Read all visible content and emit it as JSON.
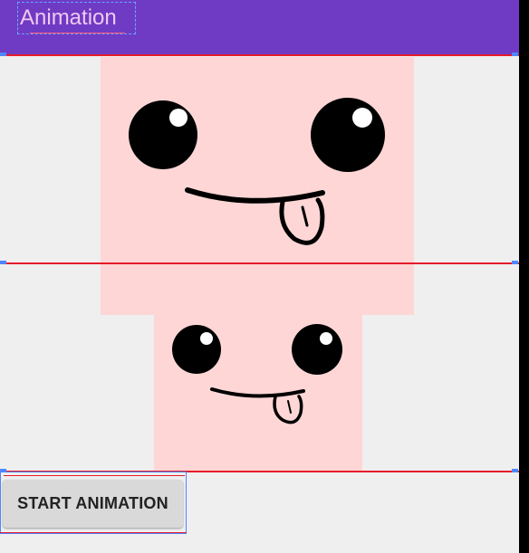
{
  "app_bar": {
    "title": "Animation",
    "color": "#6f3bc4",
    "title_color": "#f1c8ef"
  },
  "canvas": {
    "face_background": "#ffd6d6",
    "screen_background": "#efefef",
    "guide_color": "#e51b2a",
    "selection_color": "#4f86ff"
  },
  "images": {
    "large_face_icon": "smiley-face-icon",
    "small_face_icon": "smiley-face-icon"
  },
  "controls": {
    "start_button_label": "START ANIMATION"
  }
}
